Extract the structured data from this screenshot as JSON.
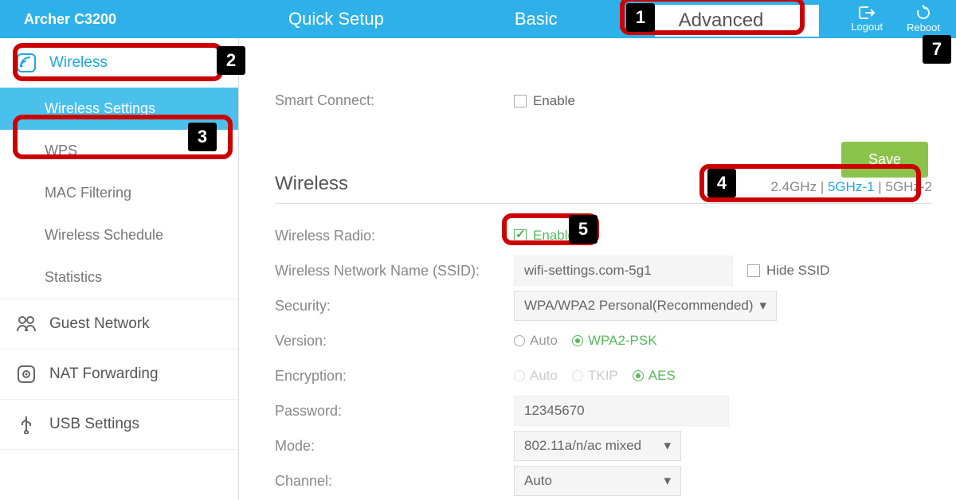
{
  "header": {
    "model": "Archer C3200",
    "tabs": {
      "quick": "Quick Setup",
      "basic": "Basic",
      "advanced": "Advanced"
    },
    "logout": "Logout",
    "reboot": "Reboot"
  },
  "sidebar": {
    "wireless": "Wireless",
    "subs": [
      "Wireless Settings",
      "WPS",
      "MAC Filtering",
      "Wireless Schedule",
      "Statistics"
    ],
    "guest": "Guest Network",
    "nat": "NAT Forwarding",
    "usb": "USB Settings"
  },
  "smart_connect": {
    "label": "Smart Connect:",
    "enable": "Enable"
  },
  "save": "Save",
  "section": {
    "title": "Wireless",
    "bands": {
      "a": "2.4GHz",
      "b": "5GHz-1",
      "c": "5GHz-2",
      "sep": " | "
    }
  },
  "form": {
    "radio_lbl": "Wireless Radio:",
    "radio_enable": "Enable",
    "ssid_lbl": "Wireless Network Name (SSID):",
    "ssid_val": "wifi-settings.com-5g1",
    "hide": "Hide SSID",
    "sec_lbl": "Security:",
    "sec_val": "WPA/WPA2 Personal(Recommended)",
    "ver_lbl": "Version:",
    "ver_auto": "Auto",
    "ver_wpa2": "WPA2-PSK",
    "enc_lbl": "Encryption:",
    "enc_auto": "Auto",
    "enc_tkip": "TKIP",
    "enc_aes": "AES",
    "pwd_lbl": "Password:",
    "pwd_val": "12345670",
    "mode_lbl": "Mode:",
    "mode_val": "802.11a/n/ac mixed",
    "chan_lbl": "Channel:",
    "chan_val": "Auto"
  },
  "annotations": {
    "1": "1",
    "2": "2",
    "3": "3",
    "4": "4",
    "5": "5",
    "7": "7"
  }
}
